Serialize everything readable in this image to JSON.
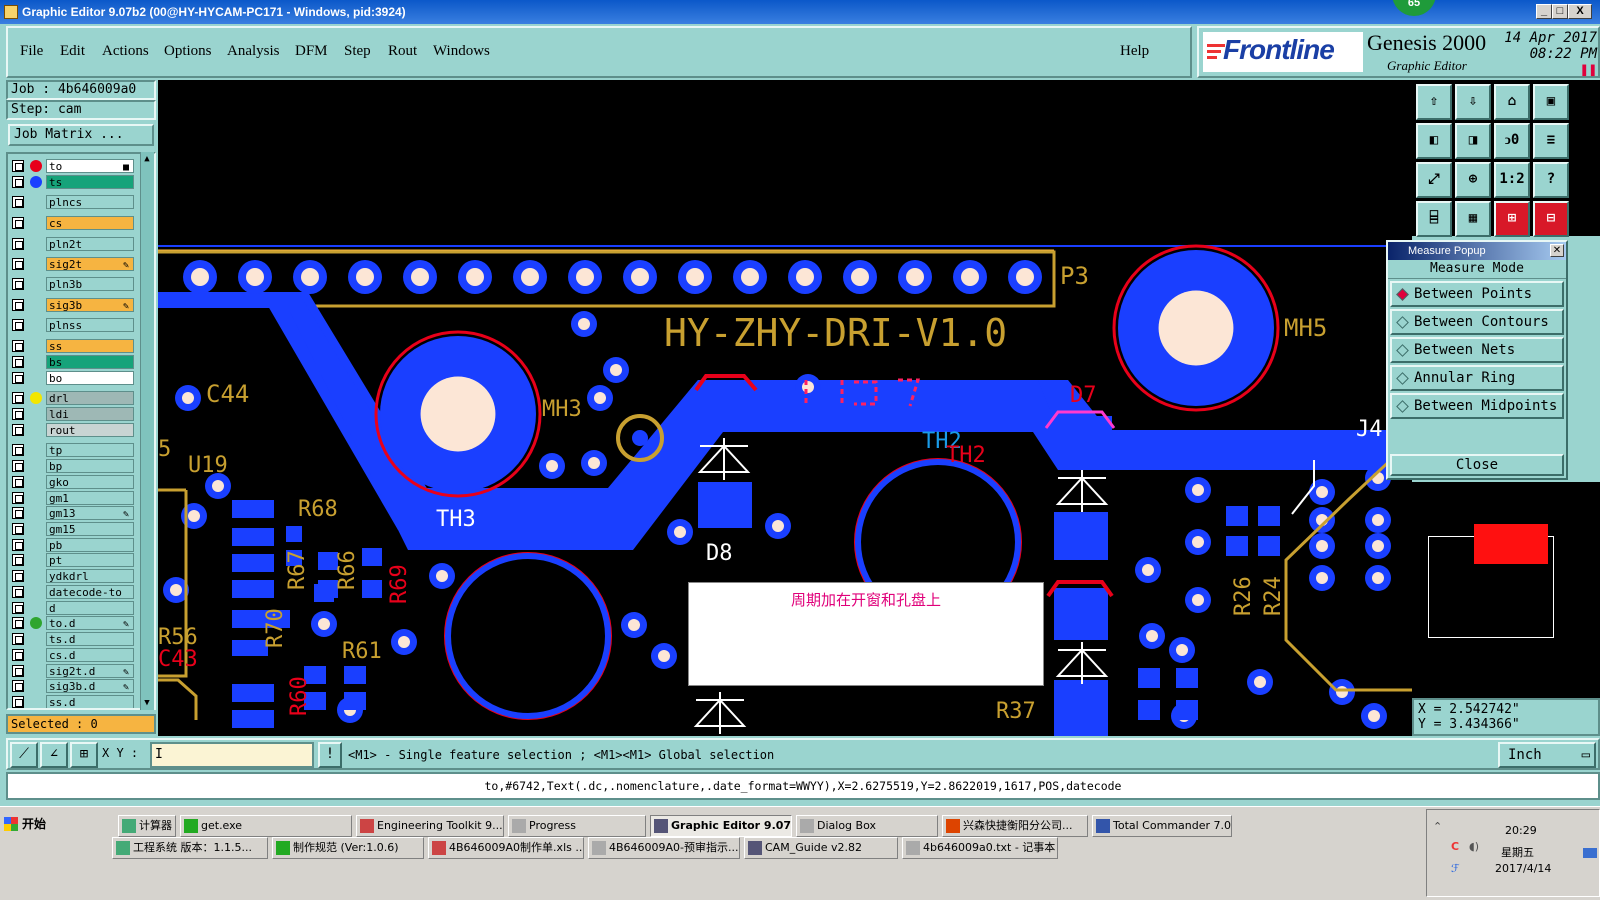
{
  "window": {
    "title": "Graphic Editor 9.07b2 (00@HY-HYCAM-PC171 - Windows, pid:3924)",
    "badge": "65",
    "controls": [
      "_",
      "□",
      "X"
    ]
  },
  "menu": [
    "File",
    "Edit",
    "Actions",
    "Options",
    "Analysis",
    "DFM",
    "Step",
    "Rout",
    "Windows"
  ],
  "help": "Help",
  "brand": {
    "logo": "Frontline",
    "product": "Genesis 2000",
    "subtitle": "Graphic Editor",
    "date": "14 Apr 2017",
    "time": "08:22 PM"
  },
  "job": {
    "job_label": "Job : 4b646009a0",
    "step_label": "Step: cam",
    "matrix_button": "Job Matrix ..."
  },
  "layers": [
    {
      "name": "to",
      "color": "#ffffff",
      "dot": "#e8001a",
      "edit": "■"
    },
    {
      "name": "ts",
      "color": "#16a37a",
      "dot": "#1a3fff",
      "edit": ""
    },
    {
      "name": "plncs",
      "color": "#9ad4cf",
      "dot": "",
      "edit": ""
    },
    {
      "name": "cs",
      "color": "#f6b441",
      "dot": "",
      "edit": ""
    },
    {
      "name": "pln2t",
      "color": "#9ad4cf",
      "dot": "",
      "edit": ""
    },
    {
      "name": "sig2t",
      "color": "#f6b441",
      "dot": "",
      "edit": "✎"
    },
    {
      "name": "pln3b",
      "color": "#9ad4cf",
      "dot": "",
      "edit": ""
    },
    {
      "name": "sig3b",
      "color": "#f6b441",
      "dot": "",
      "edit": "✎"
    },
    {
      "name": "plnss",
      "color": "#9ad4cf",
      "dot": "",
      "edit": ""
    },
    {
      "name": "ss",
      "color": "#f6b441",
      "dot": "",
      "edit": ""
    },
    {
      "name": "bs",
      "color": "#16a37a",
      "dot": "",
      "edit": ""
    },
    {
      "name": "bo",
      "color": "#ffffff",
      "dot": "",
      "edit": ""
    },
    {
      "name": "drl",
      "color": "#9eb8b5",
      "dot": "#f3e600",
      "edit": ""
    },
    {
      "name": "ldi",
      "color": "#9eb8b5",
      "dot": "",
      "edit": ""
    },
    {
      "name": "rout",
      "color": "#c8d4d3",
      "dot": "",
      "edit": ""
    },
    {
      "name": "tp",
      "color": "#9ad4cf",
      "dot": "",
      "edit": ""
    },
    {
      "name": "bp",
      "color": "#9ad4cf",
      "dot": "",
      "edit": ""
    },
    {
      "name": "gko",
      "color": "#9ad4cf",
      "dot": "",
      "edit": ""
    },
    {
      "name": "gm1",
      "color": "#9ad4cf",
      "dot": "",
      "edit": ""
    },
    {
      "name": "gm13",
      "color": "#9ad4cf",
      "dot": "",
      "edit": "✎"
    },
    {
      "name": "gm15",
      "color": "#9ad4cf",
      "dot": "",
      "edit": ""
    },
    {
      "name": "pb",
      "color": "#9ad4cf",
      "dot": "",
      "edit": ""
    },
    {
      "name": "pt",
      "color": "#9ad4cf",
      "dot": "",
      "edit": ""
    },
    {
      "name": "ydkdrl",
      "color": "#9ad4cf",
      "dot": "",
      "edit": ""
    },
    {
      "name": "datecode-to",
      "color": "#9ad4cf",
      "dot": "",
      "edit": ""
    },
    {
      "name": "d",
      "color": "#9ad4cf",
      "dot": "",
      "edit": ""
    },
    {
      "name": "to.d",
      "color": "#9ad4cf",
      "dot": "#2fa52f",
      "edit": "✎"
    },
    {
      "name": "ts.d",
      "color": "#9ad4cf",
      "dot": "",
      "edit": ""
    },
    {
      "name": "cs.d",
      "color": "#9ad4cf",
      "dot": "",
      "edit": ""
    },
    {
      "name": "sig2t.d",
      "color": "#9ad4cf",
      "dot": "",
      "edit": "✎"
    },
    {
      "name": "sig3b.d",
      "color": "#9ad4cf",
      "dot": "",
      "edit": "✎"
    },
    {
      "name": "ss.d",
      "color": "#9ad4cf",
      "dot": "",
      "edit": ""
    }
  ],
  "selected": "Selected : 0",
  "board": {
    "title": "HY-ZHY-DRI-V1.0",
    "labels": [
      "P3",
      "MH5",
      "MH3",
      "C44",
      "U19",
      "R68",
      "TH3",
      "D8",
      "TH2",
      "TH2",
      "D7",
      "J4",
      "R67",
      "R66",
      "R69",
      "R70",
      "R56",
      "C43",
      "R61",
      "R60",
      "R26",
      "R24",
      "R37",
      "5"
    ],
    "note": "周期加在开窗和孔盘上"
  },
  "toolbar_icons": [
    "import-icon",
    "export-icon",
    "home-icon",
    "window-icon",
    "pan-left-icon",
    "pan-right-icon",
    "mirror-icon",
    "flip-icon",
    "zoom-fit-icon",
    "zoom-center-icon",
    "scale-icon",
    "help-icon",
    "filter-icon",
    "grid-icon",
    "layer-red-icon",
    "layer-blue-icon"
  ],
  "toolbar_labels": [
    "⇧",
    "⇩",
    "⌂",
    "▣",
    "◧",
    "◨",
    "ↄ0",
    "≡",
    "⤢",
    "⊕",
    "1:2",
    "?",
    "⌸",
    "▦",
    "⊞",
    "⊟"
  ],
  "measure": {
    "title": "Measure Popup",
    "mode_label": "Measure Mode",
    "options": [
      "Between Points",
      "Between Contours",
      "Between Nets",
      "Annular Ring",
      "Between Midpoints"
    ],
    "selected_index": 0,
    "close": "Close"
  },
  "coords": {
    "x": "X = 2.542742\"",
    "y": "Y = 3.434366\""
  },
  "cmd": {
    "xy_label": "X Y :",
    "xy_value": "I",
    "info": "!",
    "message": "<M1> - Single feature selection ; <M1><M1> Global selection",
    "unit": "Inch"
  },
  "status": "to,#6742,Text(.dc,.nomenclature,.date_format=WWYY),X=2.6275519,Y=2.8622019,1617,POS,datecode",
  "taskbar": {
    "start": "开始",
    "row1": [
      {
        "label": "计算器",
        "active": false
      },
      {
        "label": "get.exe",
        "active": false
      },
      {
        "label": "Engineering Toolkit 9....",
        "active": false
      },
      {
        "label": "Progress",
        "active": false
      },
      {
        "label": "Graphic Editor 9.07...",
        "active": true
      },
      {
        "label": "Dialog Box",
        "active": false
      },
      {
        "label": "兴森快捷衡阳分公司...",
        "active": false
      },
      {
        "label": "Total Commander 7.0 ...",
        "active": false
      }
    ],
    "row2": [
      {
        "label": "工程系统  版本：1.1.5...",
        "active": false
      },
      {
        "label": "制作规范 (Ver:1.0.6)",
        "active": false
      },
      {
        "label": "4B646009A0制作单.xls ...",
        "active": false
      },
      {
        "label": "4B646009A0-预审指示....",
        "active": false
      },
      {
        "label": "CAM_Guide v2.82",
        "active": false
      },
      {
        "label": "4b646009a0.txt - 记事本",
        "active": false
      }
    ],
    "clock": "20:29",
    "weekday": "星期五",
    "date": "2017/4/14"
  }
}
